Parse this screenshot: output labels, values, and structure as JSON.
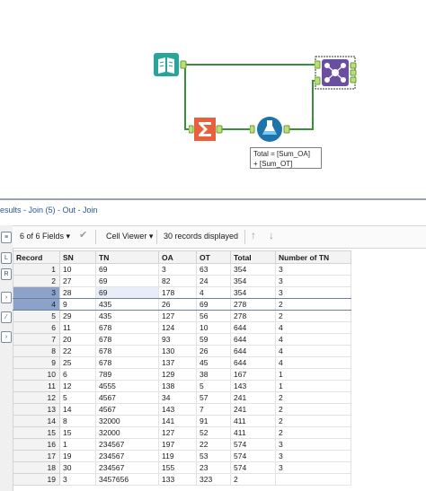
{
  "canvas": {
    "formula_note": [
      "Total = [Sum_OA]",
      "+ [Sum_OT]"
    ]
  },
  "results": {
    "title": "esults - Join (5) - Out - Join",
    "toolbar": {
      "fields_selector": "6 of 6 Fields",
      "cell_viewer": "Cell Viewer",
      "records_displayed": "30 records displayed"
    },
    "columns": [
      "Record",
      "SN",
      "TN",
      "OA",
      "OT",
      "Total",
      "Number of TN"
    ],
    "rows": [
      [
        "1",
        "10",
        "69",
        "3",
        "63",
        "354",
        "3"
      ],
      [
        "2",
        "27",
        "69",
        "82",
        "24",
        "354",
        "3"
      ],
      [
        "3",
        "28",
        "69",
        "178",
        "4",
        "354",
        "3"
      ],
      [
        "4",
        "9",
        "435",
        "26",
        "69",
        "278",
        "2"
      ],
      [
        "5",
        "29",
        "435",
        "127",
        "56",
        "278",
        "2"
      ],
      [
        "6",
        "11",
        "678",
        "124",
        "10",
        "644",
        "4"
      ],
      [
        "7",
        "20",
        "678",
        "93",
        "59",
        "644",
        "4"
      ],
      [
        "8",
        "22",
        "678",
        "130",
        "26",
        "644",
        "4"
      ],
      [
        "9",
        "25",
        "678",
        "137",
        "45",
        "644",
        "4"
      ],
      [
        "10",
        "6",
        "789",
        "129",
        "38",
        "167",
        "1"
      ],
      [
        "11",
        "12",
        "4555",
        "138",
        "5",
        "143",
        "1"
      ],
      [
        "12",
        "5",
        "4567",
        "34",
        "57",
        "241",
        "2"
      ],
      [
        "13",
        "14",
        "4567",
        "143",
        "7",
        "241",
        "2"
      ],
      [
        "14",
        "8",
        "32000",
        "141",
        "91",
        "411",
        "2"
      ],
      [
        "15",
        "15",
        "32000",
        "127",
        "52",
        "411",
        "2"
      ],
      [
        "16",
        "1",
        "234567",
        "197",
        "22",
        "574",
        "3"
      ],
      [
        "17",
        "19",
        "234567",
        "119",
        "53",
        "574",
        "3"
      ],
      [
        "18",
        "30",
        "234567",
        "155",
        "23",
        "574",
        "3"
      ],
      [
        "19",
        "3",
        "3457656",
        "133",
        "323",
        "2"
      ]
    ]
  },
  "colors": {
    "connection": "#3a8f3a",
    "input_tool": "#26a69a",
    "summarize_tool": "#e8603c",
    "formula_tool": "#1e73a8",
    "join_tool": "#6a4fa0",
    "selected_row": "#8da2c8",
    "title_text": "#2b5797"
  },
  "icons": {
    "input": "book-icon",
    "summarize": "sigma-icon",
    "formula": "flask-icon",
    "join": "join-icon",
    "check": "check-icon",
    "up": "arrow-up-icon",
    "down": "arrow-down-icon"
  }
}
